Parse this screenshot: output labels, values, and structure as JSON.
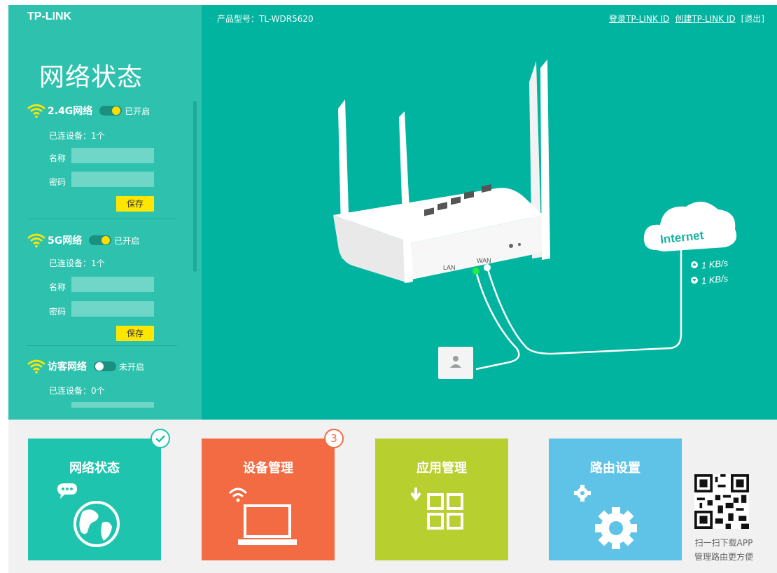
{
  "brand": {
    "logo": "TP-LINK"
  },
  "header": {
    "model_label": "产品型号：TL-WDR5620",
    "login_link": "登录TP-LINK ID",
    "create_link": "创建TP-LINK ID",
    "logout_link": "[退出]"
  },
  "sidebar": {
    "title": "网络状态",
    "networks": [
      {
        "name": "2.4G网络",
        "toggle_state": "on",
        "toggle_text": "已开启",
        "connected": "已连设备：1个",
        "name_label": "名称",
        "password_label": "密码",
        "save_label": "保存"
      },
      {
        "name": "5G网络",
        "toggle_state": "on",
        "toggle_text": "已开启",
        "connected": "已连设备：1个",
        "name_label": "名称",
        "password_label": "密码",
        "save_label": "保存"
      },
      {
        "name": "访客网络",
        "toggle_state": "off",
        "toggle_text": "未开启",
        "connected": "已连设备：0个"
      }
    ]
  },
  "illustration": {
    "lan_port_label": "LAN",
    "wan_port_label": "WAN",
    "internet_label": "Internet",
    "upload_speed": "1 KB/s",
    "download_speed": "1 KB/s"
  },
  "tiles": [
    {
      "label": "网络状态",
      "color": "#1fc4ae",
      "icon": "globe-chat-icon",
      "badge": "check"
    },
    {
      "label": "设备管理",
      "color": "#f26b43",
      "icon": "laptop-wifi-icon",
      "badge": "3"
    },
    {
      "label": "应用管理",
      "color": "#b7cf2f",
      "icon": "apps-grid-icon"
    },
    {
      "label": "路由设置",
      "color": "#5ec3e6",
      "icon": "gears-icon"
    }
  ],
  "qr": {
    "line1": "扫一扫下载APP",
    "line2": "管理路由更方便"
  },
  "colors": {
    "main_bg": "#00b4a0",
    "sidebar_bg": "#2ec2ae",
    "accent_yellow": "#ffe600"
  }
}
